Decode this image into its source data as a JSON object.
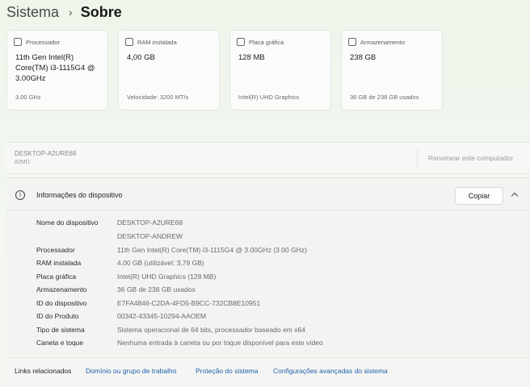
{
  "breadcrumb": {
    "parent": "Sistema",
    "separator": "›",
    "current": "Sobre"
  },
  "cards": [
    {
      "title": "Processador",
      "icon": "processor-icon",
      "value": "11th Gen Intel(R) Core(TM) i3-1115G4 @ 3.00GHz",
      "sub": "3.00 GHz"
    },
    {
      "title": "RAM instalada",
      "icon": "ram-icon",
      "value": "4,00 GB",
      "sub": "Velocidade: 3200 MT/s"
    },
    {
      "title": "Placa gráfica",
      "icon": "graphics-card-icon",
      "value": "128 MB",
      "sub": "Intel(R) UHD Graphics"
    },
    {
      "title": "Armazenamento",
      "icon": "storage-icon",
      "value": "238 GB",
      "sub": "36 GB de 238 GB usados"
    }
  ],
  "device": {
    "name": "DESKTOP-A2URE68",
    "model": "82MD",
    "rename_label": "Renomear este computador"
  },
  "info": {
    "title": "Informações do dispositivo",
    "copy_label": "Copiar",
    "specs": [
      {
        "label": "Nome do dispositivo",
        "value": "DESKTOP-A2URE68"
      },
      {
        "label": "",
        "value": "DESKTOP-ANDREW"
      },
      {
        "label": "Processador",
        "value": "11th Gen Intel(R) Core(TM) i3-1115G4 @ 3.00GHz (3.00 GHz)"
      },
      {
        "label": "RAM instalada",
        "value": "4,00 GB (utilizável: 3,79 GB)"
      },
      {
        "label": "Placa gráfica",
        "value": "Intel(R) UHD Graphics (128 MB)"
      },
      {
        "label": "Armazenamento",
        "value": "36 GB de 238 GB usados"
      },
      {
        "label": "ID do dispositivo",
        "value": "E7FA4846-C2DA-4FD5-B9CC-732CB8E10951"
      },
      {
        "label": "ID do Produto",
        "value": "00342-43345-10294-AAOEM"
      },
      {
        "label": "Tipo de sistema",
        "value": "Sistema operacional de 64 bits, processador baseado em x64"
      },
      {
        "label": "Caneta e toque",
        "value": "Nenhuma entrada à caneta ou por toque disponível para este vídeo"
      }
    ]
  },
  "related": {
    "label": "Links relacionados",
    "links": [
      "Domínio ou grupo de trabalho",
      "Proteção do sistema",
      "Configurações avançadas do sistema"
    ]
  }
}
